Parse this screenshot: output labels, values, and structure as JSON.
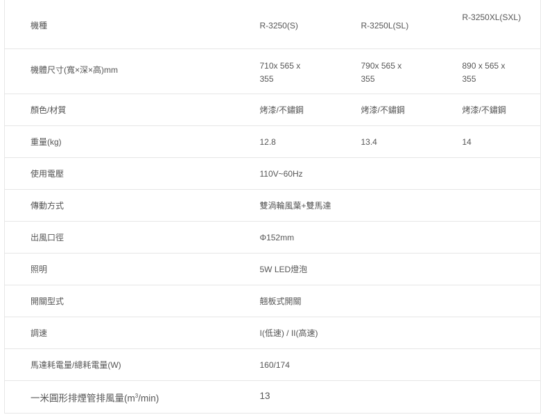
{
  "models": {
    "label": "機種",
    "values": [
      "R-3250(S)",
      "R-3250L(SL)",
      "R-3250XL(SXL)"
    ]
  },
  "rows": [
    {
      "label": "機體尺寸(寬×深×高)mm",
      "values": [
        "710x 565 x 355",
        "790x 565 x 355",
        "890 x 565 x 355"
      ]
    },
    {
      "label": "顏色/材質",
      "values": [
        "烤漆/不鏽鋼",
        "烤漆/不鏽鋼",
        "烤漆/不鏽鋼"
      ]
    },
    {
      "label": "重量(kg)",
      "values": [
        "12.8",
        "13.4",
        "14"
      ]
    },
    {
      "label": "使用電壓",
      "value": "110V~60Hz"
    },
    {
      "label": "傳動方式",
      "value": "雙渦輪風葉+雙馬達"
    },
    {
      "label": "出風口徑",
      "value": "Φ152mm"
    },
    {
      "label": "照明",
      "value": "5W LED燈泡"
    },
    {
      "label": "開關型式",
      "value": "翹板式開關"
    },
    {
      "label": "調速",
      "value": "I(低速) / II(高速)"
    },
    {
      "label": "馬達耗電量/總耗電量(W)",
      "value": "160/174"
    },
    {
      "label_prefix": "一米圓形排煙管排風量(m",
      "label_sup": "3",
      "label_suffix": "/min)",
      "value": "13"
    }
  ]
}
